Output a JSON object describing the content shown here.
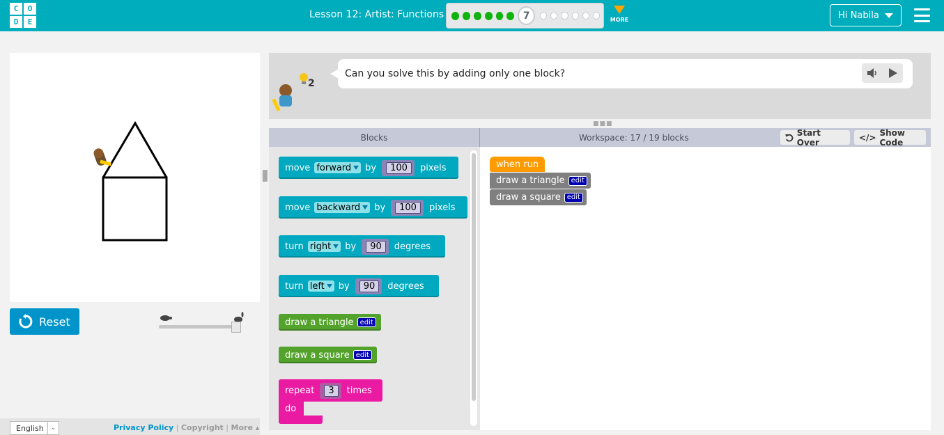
{
  "header": {
    "logo_letters": [
      "C",
      "O",
      "D",
      "E"
    ],
    "lesson_title": "Lesson 12: Artist: Functions",
    "progress": {
      "completed": 6,
      "current": "7",
      "remaining": 6
    },
    "more_label": "MORE",
    "user_label": "Hi Nabila"
  },
  "controls": {
    "reset_label": "Reset"
  },
  "footer": {
    "language": "English",
    "privacy": "Privacy Policy",
    "sep1": "|",
    "copyright": "Copyright",
    "sep2": "|",
    "more": "More ▴"
  },
  "instructions": {
    "text": "Can you solve this by adding only one block?",
    "hint_count": "2"
  },
  "toolbox": {
    "header": "Blocks",
    "blocks": [
      {
        "verb": "move",
        "dropdown": "forward",
        "by": "by",
        "value": "100",
        "unit": "pixels"
      },
      {
        "verb": "move",
        "dropdown": "backward",
        "by": "by",
        "value": "100",
        "unit": "pixels"
      },
      {
        "verb": "turn",
        "dropdown": "right",
        "by": "by",
        "value": "90",
        "unit": "degrees"
      },
      {
        "verb": "turn",
        "dropdown": "left",
        "by": "by",
        "value": "90",
        "unit": "degrees"
      }
    ],
    "func_triangle": "draw a triangle",
    "func_square": "draw a square",
    "edit_label": "edit",
    "repeat_label": "repeat",
    "repeat_value": "3",
    "times_label": "times",
    "do_label": "do"
  },
  "workspace": {
    "header": "Workspace: 17 / 19 blocks",
    "start_over": "Start Over",
    "show_code": "Show Code",
    "when_run": "when run",
    "block1": "draw a triangle",
    "block2": "draw a square",
    "edit_label": "edit"
  },
  "colors": {
    "header_bg": "#00adbc",
    "move_turn_block": "#00a9bf",
    "function_block": "#52a22b",
    "repeat_block": "#ea1aa3",
    "when_run_block": "#ff9b00",
    "progress_done": "#0eb30e"
  }
}
